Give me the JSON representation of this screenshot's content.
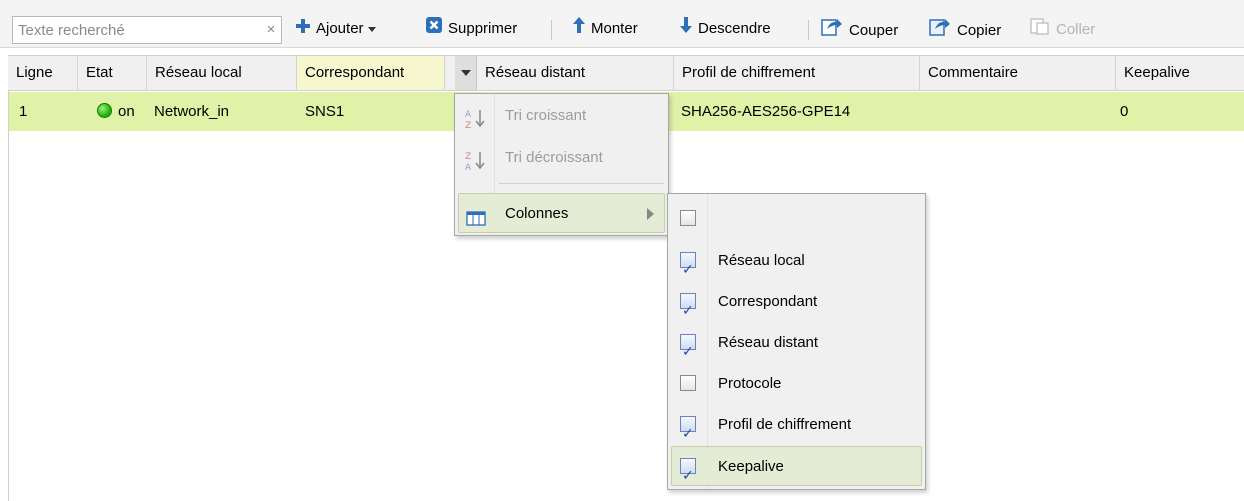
{
  "toolbar": {
    "search_placeholder": "Texte recherché",
    "clear_label": "×",
    "add_label": "Ajouter",
    "delete_label": "Supprimer",
    "up_label": "Monter",
    "down_label": "Descendre",
    "cut_label": "Couper",
    "copy_label": "Copier",
    "paste_label": "Coller"
  },
  "grid": {
    "columns": [
      "Ligne",
      "Etat",
      "Réseau local",
      "Correspondant",
      "Réseau distant",
      "Profil de chiffrement",
      "Commentaire",
      "Keepalive"
    ],
    "rows": [
      {
        "ligne": "1",
        "etat": "on",
        "reseau_local": "Network_in",
        "correspondant": "SNS1",
        "reseau_distant": "",
        "profil": "SHA256-AES256-GPE14",
        "commentaire": "",
        "keepalive": "0"
      }
    ]
  },
  "column_menu": {
    "sort_asc": "Tri croissant",
    "sort_desc": "Tri décroissant",
    "columns": "Colonnes"
  },
  "columns_submenu": [
    {
      "label": "",
      "checked": false
    },
    {
      "label": "Réseau local",
      "checked": true
    },
    {
      "label": "Correspondant",
      "checked": true
    },
    {
      "label": "Réseau distant",
      "checked": true
    },
    {
      "label": "Protocole",
      "checked": false
    },
    {
      "label": "Profil de chiffrement",
      "checked": true
    },
    {
      "label": "Keepalive",
      "checked": true
    }
  ],
  "colors": {
    "selected_row": "#dff2a8",
    "status_on": "#24b50f",
    "toolbar_icon_blue": "#2e6fb8"
  }
}
